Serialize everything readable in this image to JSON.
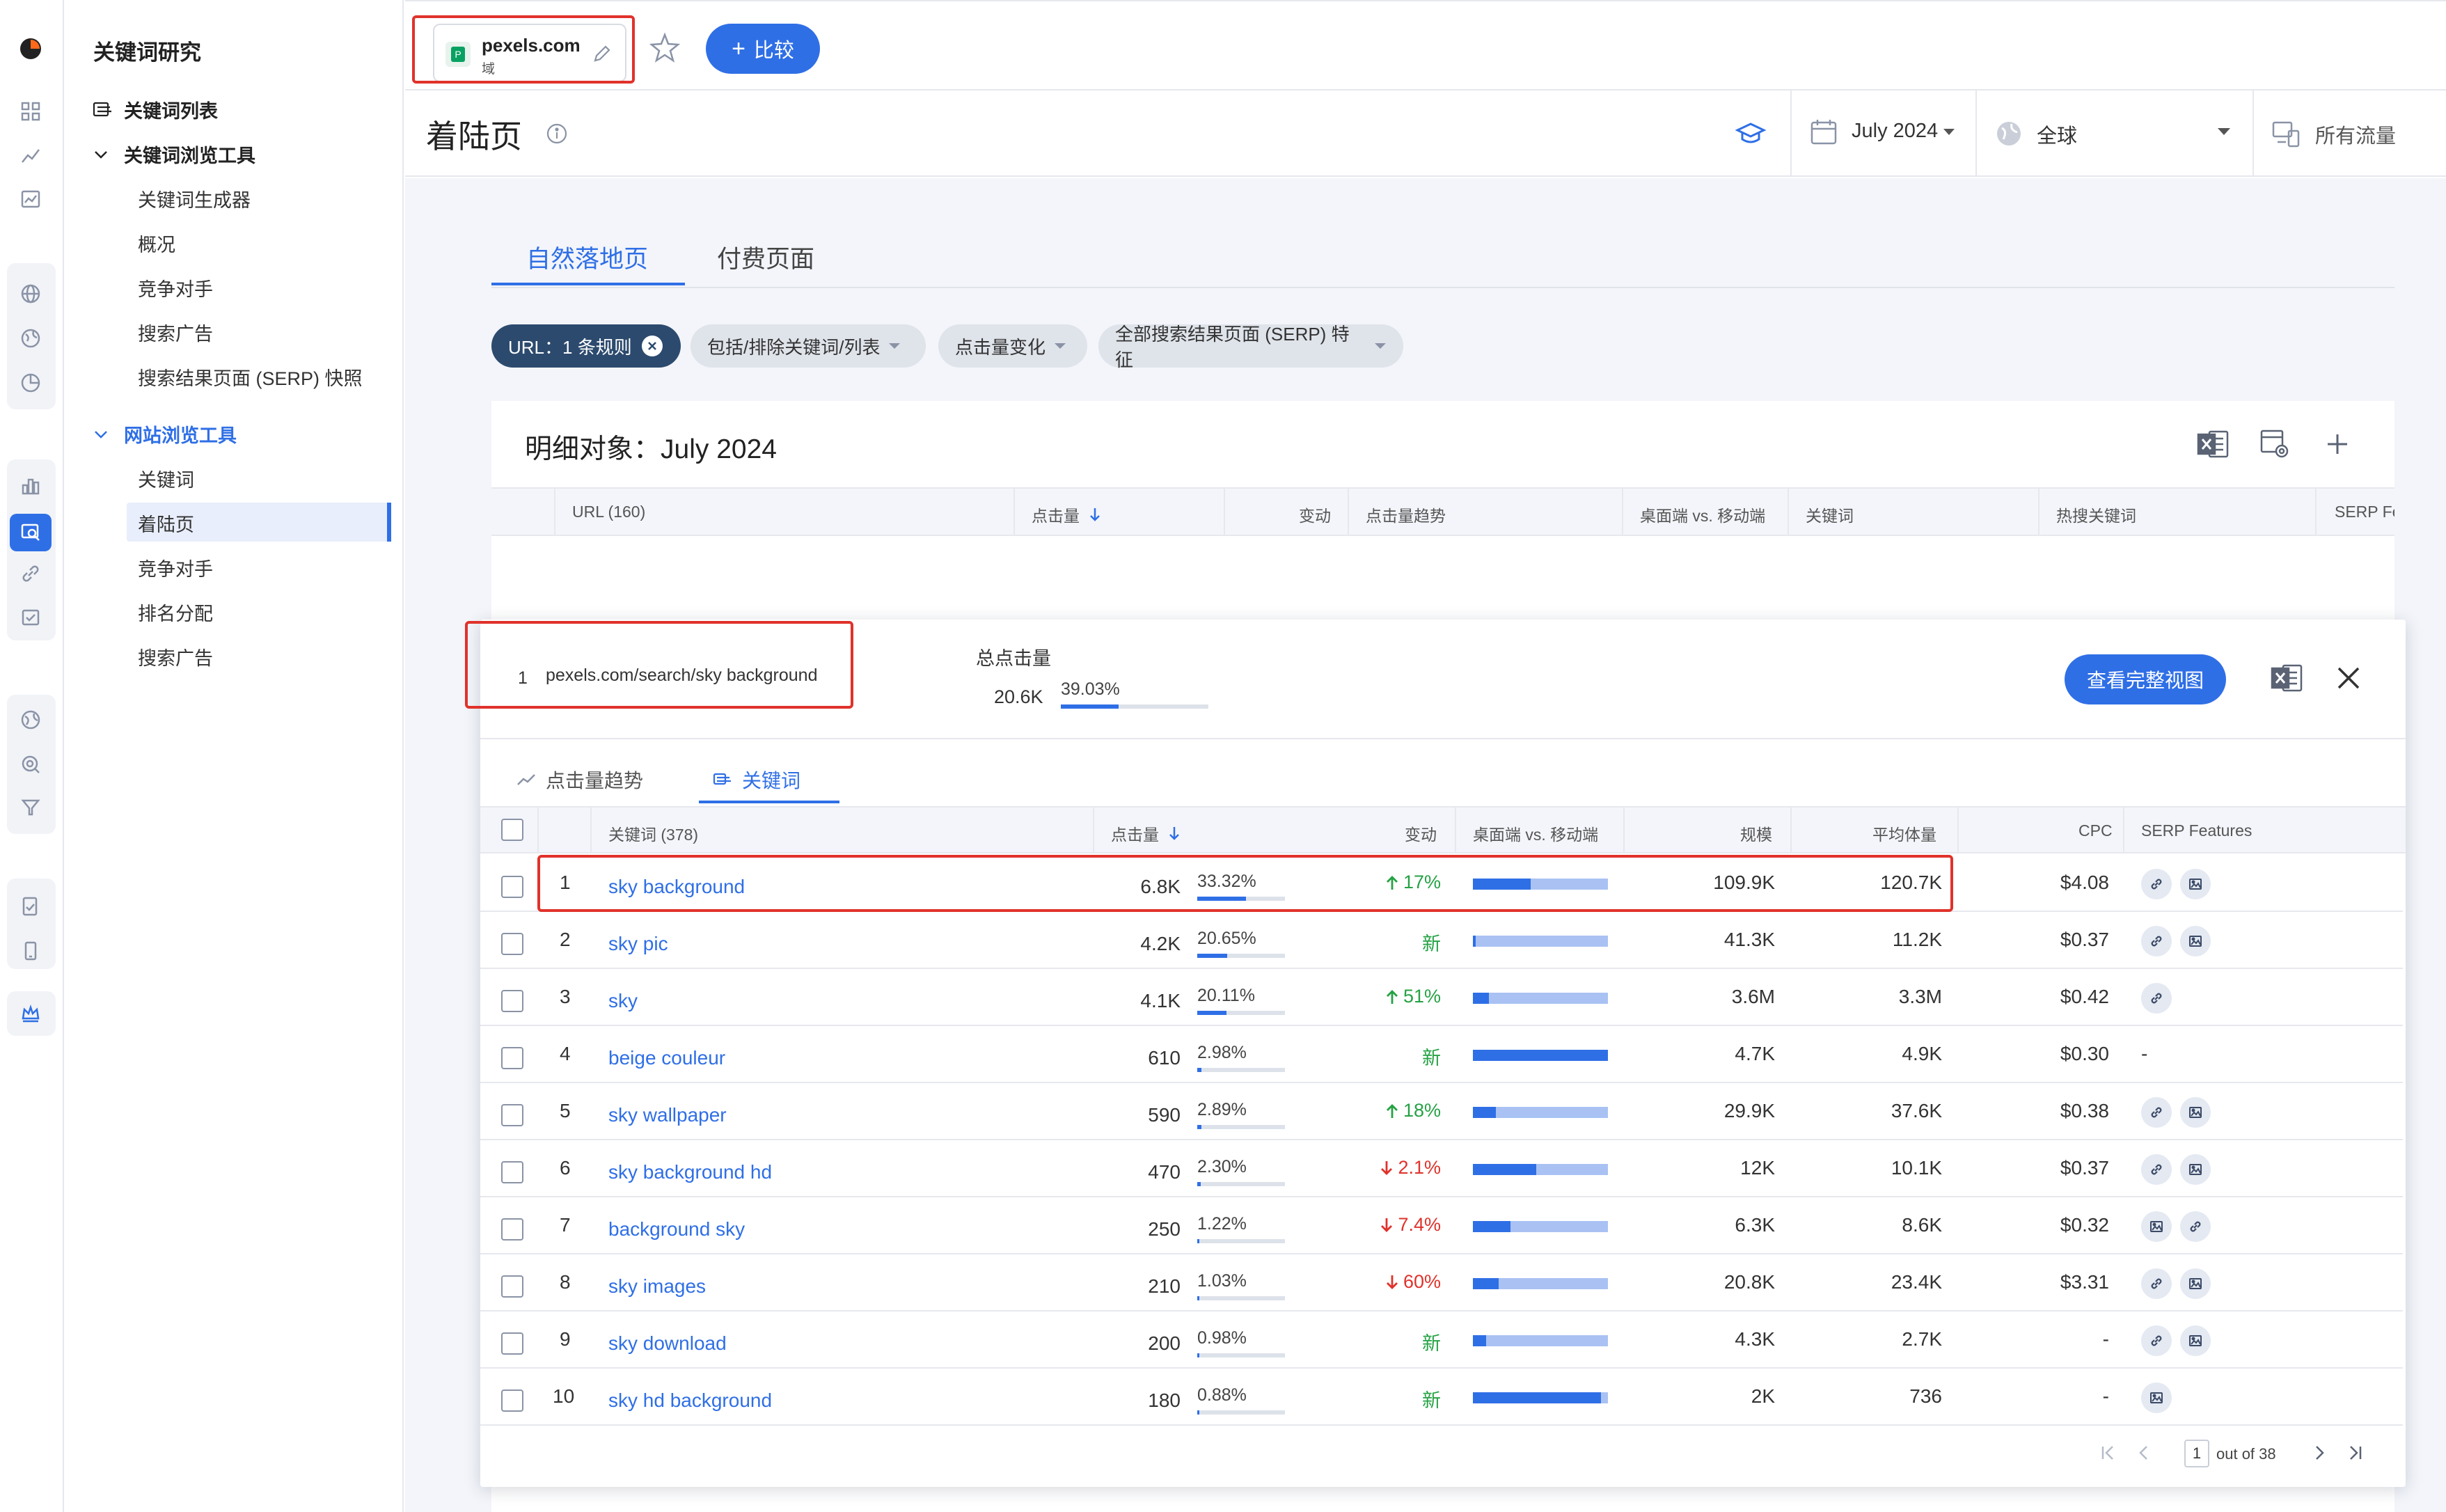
{
  "sidebar": {
    "title": "关键词研究",
    "items": [
      {
        "label": "关键词列表"
      },
      {
        "label": "关键词浏览工具"
      },
      {
        "label": "关键词生成器"
      },
      {
        "label": "概况"
      },
      {
        "label": "竞争对手"
      },
      {
        "label": "搜索广告"
      },
      {
        "label": "搜索结果页面 (SERP) 快照"
      },
      {
        "label": "网站浏览工具"
      },
      {
        "label": "关键词"
      },
      {
        "label": "着陆页"
      },
      {
        "label": "竞争对手"
      },
      {
        "label": "排名分配"
      },
      {
        "label": "搜索广告"
      }
    ]
  },
  "topbar": {
    "domain": "pexels.com",
    "domain_type": "域",
    "compare_label": "比较"
  },
  "header": {
    "page_title": "着陆页",
    "date": "July 2024",
    "region": "全球",
    "traffic": "所有流量"
  },
  "tabs": [
    {
      "label": "自然落地页",
      "active": true
    },
    {
      "label": "付费页面",
      "active": false
    }
  ],
  "filters": [
    {
      "label": "URL：1 条规则"
    },
    {
      "label": "包括/排除关键词/列表"
    },
    {
      "label": "点击量变化"
    },
    {
      "label": "全部搜索结果页面 (SERP) 特征"
    }
  ],
  "breakdown": {
    "title": "明细对象：July 2024",
    "columns": [
      "URL (160)",
      "点击量",
      "变动",
      "点击量趋势",
      "桌面端 vs. 移动端",
      "关键词",
      "热搜关键词",
      "SERP Fe"
    ]
  },
  "detail": {
    "rank": "1",
    "url": "pexels.com/search/sky background",
    "total_clicks_label": "总点击量",
    "total_clicks": "20.6K",
    "total_share": "39.03%",
    "total_share_value": 39.03,
    "full_view_label": "查看完整视图",
    "subtabs": [
      {
        "label": "点击量趋势",
        "active": false
      },
      {
        "label": "关键词",
        "active": true
      }
    ],
    "columns": {
      "keyword": "关键词 (378)",
      "clicks": "点击量",
      "change": "变动",
      "dvm": "桌面端 vs. 移动端",
      "scale": "规模",
      "avg_volume": "平均体量",
      "cpc": "CPC",
      "serp": "SERP Features"
    },
    "rows": [
      {
        "n": "1",
        "keyword": "sky background",
        "clicks": "6.8K",
        "share": "33.32%",
        "share_value": 33.32,
        "change": "17%",
        "change_dir": "up",
        "desktop_share": 0.43,
        "scale": "109.9K",
        "avg_volume": "120.7K",
        "cpc": "$4.08",
        "serp": [
          "link-icon",
          "image-icon"
        ]
      },
      {
        "n": "2",
        "keyword": "sky pic",
        "clicks": "4.2K",
        "share": "20.65%",
        "share_value": 20.65,
        "change": "新",
        "change_dir": "new",
        "desktop_share": 0.02,
        "scale": "41.3K",
        "avg_volume": "11.2K",
        "cpc": "$0.37",
        "serp": [
          "link-icon",
          "image-icon"
        ]
      },
      {
        "n": "3",
        "keyword": "sky",
        "clicks": "4.1K",
        "share": "20.11%",
        "share_value": 20.11,
        "change": "51%",
        "change_dir": "up",
        "desktop_share": 0.12,
        "scale": "3.6M",
        "avg_volume": "3.3M",
        "cpc": "$0.42",
        "serp": [
          "link-icon"
        ]
      },
      {
        "n": "4",
        "keyword": "beige couleur",
        "clicks": "610",
        "share": "2.98%",
        "share_value": 2.98,
        "change": "新",
        "change_dir": "new",
        "desktop_share": 1.0,
        "scale": "4.7K",
        "avg_volume": "4.9K",
        "cpc": "$0.30",
        "serp_text": "-",
        "serp": []
      },
      {
        "n": "5",
        "keyword": "sky wallpaper",
        "clicks": "590",
        "share": "2.89%",
        "share_value": 2.89,
        "change": "18%",
        "change_dir": "up",
        "desktop_share": 0.17,
        "scale": "29.9K",
        "avg_volume": "37.6K",
        "cpc": "$0.38",
        "serp": [
          "link-icon",
          "image-icon"
        ]
      },
      {
        "n": "6",
        "keyword": "sky background hd",
        "clicks": "470",
        "share": "2.30%",
        "share_value": 2.3,
        "change": "2.1%",
        "change_dir": "down",
        "desktop_share": 0.47,
        "scale": "12K",
        "avg_volume": "10.1K",
        "cpc": "$0.37",
        "serp": [
          "link-icon",
          "image-icon"
        ]
      },
      {
        "n": "7",
        "keyword": "background sky",
        "clicks": "250",
        "share": "1.22%",
        "share_value": 1.22,
        "change": "7.4%",
        "change_dir": "down",
        "desktop_share": 0.28,
        "scale": "6.3K",
        "avg_volume": "8.6K",
        "cpc": "$0.32",
        "serp": [
          "image-icon",
          "link-icon"
        ]
      },
      {
        "n": "8",
        "keyword": "sky images",
        "clicks": "210",
        "share": "1.03%",
        "share_value": 1.03,
        "change": "60%",
        "change_dir": "down",
        "desktop_share": 0.19,
        "scale": "20.8K",
        "avg_volume": "23.4K",
        "cpc": "$3.31",
        "serp": [
          "link-icon",
          "image-icon"
        ]
      },
      {
        "n": "9",
        "keyword": "sky download",
        "clicks": "200",
        "share": "0.98%",
        "share_value": 0.98,
        "change": "新",
        "change_dir": "new",
        "desktop_share": 0.1,
        "scale": "4.3K",
        "avg_volume": "2.7K",
        "cpc": "-",
        "serp": [
          "link-icon",
          "image-icon"
        ]
      },
      {
        "n": "10",
        "keyword": "sky hd background",
        "clicks": "180",
        "share": "0.88%",
        "share_value": 0.88,
        "change": "新",
        "change_dir": "new",
        "desktop_share": 0.95,
        "scale": "2K",
        "avg_volume": "736",
        "cpc": "-",
        "serp": [
          "image-icon"
        ]
      }
    ],
    "pagination": {
      "page": "1",
      "total": "out of 38"
    }
  }
}
